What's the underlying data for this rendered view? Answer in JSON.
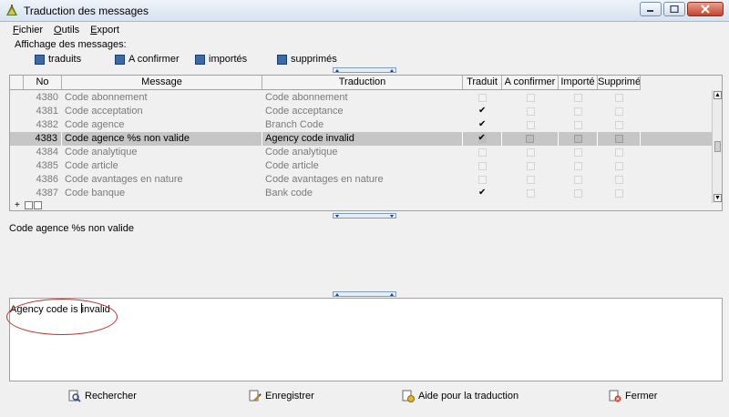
{
  "window": {
    "title": "Traduction des messages"
  },
  "menu": [
    {
      "label": "Fichier",
      "hotkey": "F",
      "rest": "ichier"
    },
    {
      "label": "Outils",
      "hotkey": "O",
      "rest": "utils"
    },
    {
      "label": "Export",
      "hotkey": "E",
      "rest": "xport"
    }
  ],
  "filters": {
    "label": "Affichage des messages:",
    "items": [
      {
        "label": "traduits",
        "checked": true
      },
      {
        "label": "A confirmer",
        "checked": true
      },
      {
        "label": "importés",
        "checked": true
      },
      {
        "label": "supprimés",
        "checked": true
      }
    ]
  },
  "grid": {
    "columns": [
      "No",
      "Message",
      "Traduction",
      "Traduit",
      "A confirmer",
      "Importé",
      "Supprimé"
    ],
    "rows": [
      {
        "no": "4380",
        "message": "Code abonnement",
        "traduction": "Code abonnement",
        "traduit": false,
        "confirmer": false,
        "importe": false,
        "supprime": false
      },
      {
        "no": "4381",
        "message": "Code acceptation",
        "traduction": "Code acceptance",
        "traduit": true,
        "confirmer": false,
        "importe": false,
        "supprime": false
      },
      {
        "no": "4382",
        "message": "Code agence",
        "traduction": "Branch Code",
        "traduit": true,
        "confirmer": false,
        "importe": false,
        "supprime": false
      },
      {
        "no": "4383",
        "message": "Code agence %s non valide",
        "traduction": "Agency code invalid",
        "traduit": true,
        "confirmer": false,
        "importe": false,
        "supprime": false,
        "selected": true
      },
      {
        "no": "4384",
        "message": "Code analytique",
        "traduction": "Code analytique",
        "traduit": false,
        "confirmer": false,
        "importe": false,
        "supprime": false
      },
      {
        "no": "4385",
        "message": "Code article",
        "traduction": "Code article",
        "traduit": false,
        "confirmer": false,
        "importe": false,
        "supprime": false
      },
      {
        "no": "4386",
        "message": "Code avantages en nature",
        "traduction": "Code avantages en nature",
        "traduit": false,
        "confirmer": false,
        "importe": false,
        "supprime": false
      },
      {
        "no": "4387",
        "message": "Code banque",
        "traduction": "Bank code",
        "traduit": true,
        "confirmer": false,
        "importe": false,
        "supprime": false
      }
    ]
  },
  "source_text": "Code agence %s non valide",
  "target_text": {
    "before_caret": "Agency code is ",
    "after_caret": "invalid"
  },
  "buttons": {
    "search": "Rechercher",
    "save": "Enregistrer",
    "help": "Aide pour la traduction",
    "close": "Fermer"
  },
  "colors": {
    "filter_checked": "#3a6ba8",
    "annotation_ellipse": "#c0302c",
    "selected_row": "#c6c6c6"
  }
}
